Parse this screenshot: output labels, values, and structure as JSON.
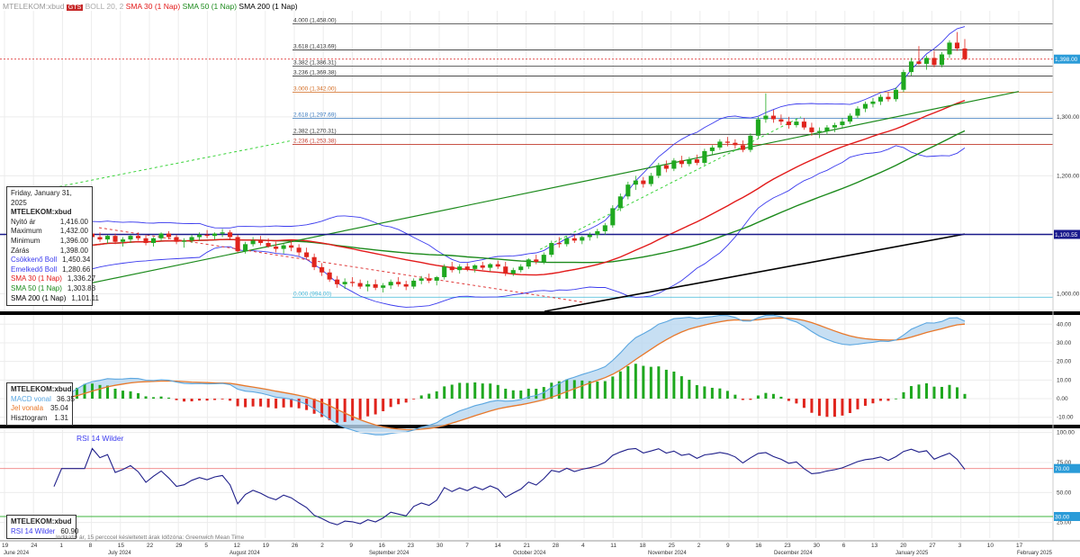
{
  "header": {
    "symbol_label": "MTELEKOM:xbud",
    "badge_label": "GTS",
    "extra_label": "BOLL 20, 2",
    "sma30_label": "SMA 30 (1 Nap)",
    "sma50_label": "SMA 50 (1 Nap)",
    "sma200_label": "SMA 200 (1 Nap)"
  },
  "colors": {
    "up": "#1fa81f",
    "down": "#e0241c",
    "sma30": "#e21a1a",
    "sma50": "#1c8a1c",
    "sma200": "#000000",
    "boll": "#3a3aee",
    "macd": "#5aa6e0",
    "signal": "#e8782a",
    "rsi": "#1f1f8a",
    "fib": "#d2691e"
  },
  "price_info": {
    "date": "Friday, January 31, 2025",
    "symbol": "MTELEKOM:xbud",
    "rows": [
      {
        "label": "Nyitó ár",
        "value": "1,416.00"
      },
      {
        "label": "Maximum",
        "value": "1,432.00"
      },
      {
        "label": "Minimum",
        "value": "1,396.00"
      },
      {
        "label": "Zárás",
        "value": "1,398.00"
      },
      {
        "label": "Csökkenő Boll",
        "value": "1,450.34"
      },
      {
        "label": "Emelkedő Boll",
        "value": "1,280.66"
      },
      {
        "label": "SMA 30 (1 Nap)",
        "value": "1,336.27"
      },
      {
        "label": "SMA 50 (1 Nap)",
        "value": "1,303.88"
      },
      {
        "label": "SMA 200 (1 Nap)",
        "value": "1,101.11"
      }
    ]
  },
  "macd_info": {
    "symbol": "MTELEKOM:xbud",
    "rows": [
      {
        "label": "MACD vonal",
        "value": "36.35"
      },
      {
        "label": "Jel vonala",
        "value": "35.04"
      },
      {
        "label": "Hisztogram",
        "value": "1.31"
      }
    ]
  },
  "rsi_info": {
    "title": "RSI 14 Wilder",
    "symbol": "MTELEKOM:xbud",
    "label": "RSI 14 Wilder",
    "value": "60.90"
  },
  "footer_note": "Indikatív ár, 15 percccel késleltetett árak   Időzóna: Greenwich Mean Time",
  "chart_data": {
    "type": "candlestick",
    "price_axis": {
      "ticks": [
        "1,000.00",
        "1,100.00",
        "1,200.00",
        "1,300.00"
      ],
      "ylim": [
        970,
        1480
      ]
    },
    "price_tags": {
      "current": "1,398.00",
      "sma200": "1,100.55"
    },
    "fib_levels": [
      {
        "label": "4.000 (1,458.00)",
        "value": 1458
      },
      {
        "label": "3.618 (1,413.69)",
        "value": 1413.69
      },
      {
        "label": "3.382 (1,386.31)",
        "value": 1386.31
      },
      {
        "label": "3.236 (1,369.38)",
        "value": 1369.38
      },
      {
        "label": "3.000 (1,342.00)",
        "value": 1342
      },
      {
        "label": "2.618 (1,297.69)",
        "value": 1297.69
      },
      {
        "label": "2.382 (1,270.31)",
        "value": 1270.31
      },
      {
        "label": "2.236 (1,253.38)",
        "value": 1253.38
      },
      {
        "label": "0.000 (994.00)",
        "value": 994
      }
    ],
    "candles": [
      [
        1045,
        1058,
        1040,
        1055
      ],
      [
        1055,
        1070,
        1050,
        1066
      ],
      [
        1066,
        1085,
        1062,
        1080
      ],
      [
        1080,
        1100,
        1075,
        1095
      ],
      [
        1095,
        1110,
        1088,
        1102
      ],
      [
        1102,
        1108,
        1090,
        1096
      ],
      [
        1096,
        1104,
        1088,
        1092
      ],
      [
        1092,
        1100,
        1085,
        1098
      ],
      [
        1098,
        1102,
        1084,
        1088
      ],
      [
        1088,
        1096,
        1080,
        1092
      ],
      [
        1092,
        1100,
        1086,
        1098
      ],
      [
        1098,
        1104,
        1090,
        1094
      ],
      [
        1094,
        1100,
        1082,
        1086
      ],
      [
        1086,
        1096,
        1080,
        1094
      ],
      [
        1094,
        1104,
        1090,
        1102
      ],
      [
        1102,
        1106,
        1092,
        1096
      ],
      [
        1096,
        1100,
        1084,
        1088
      ],
      [
        1088,
        1094,
        1078,
        1090
      ],
      [
        1090,
        1100,
        1086,
        1096
      ],
      [
        1096,
        1104,
        1090,
        1100
      ],
      [
        1100,
        1108,
        1094,
        1098
      ],
      [
        1098,
        1104,
        1092,
        1102
      ],
      [
        1102,
        1110,
        1096,
        1104
      ],
      [
        1104,
        1108,
        1092,
        1096
      ],
      [
        1096,
        1100,
        1070,
        1072
      ],
      [
        1072,
        1088,
        1068,
        1084
      ],
      [
        1084,
        1096,
        1080,
        1090
      ],
      [
        1090,
        1098,
        1082,
        1086
      ],
      [
        1086,
        1094,
        1078,
        1080
      ],
      [
        1080,
        1088,
        1070,
        1076
      ],
      [
        1076,
        1086,
        1068,
        1082
      ],
      [
        1082,
        1090,
        1072,
        1078
      ],
      [
        1078,
        1084,
        1064,
        1070
      ],
      [
        1070,
        1078,
        1058,
        1062
      ],
      [
        1062,
        1068,
        1040,
        1045
      ],
      [
        1045,
        1052,
        1030,
        1036
      ],
      [
        1036,
        1042,
        1020,
        1024
      ],
      [
        1024,
        1030,
        1010,
        1016
      ],
      [
        1016,
        1026,
        1008,
        1020
      ],
      [
        1020,
        1028,
        1012,
        1018
      ],
      [
        1018,
        1024,
        1008,
        1012
      ],
      [
        1012,
        1022,
        1004,
        1016
      ],
      [
        1016,
        1024,
        1006,
        1010
      ],
      [
        1010,
        1018,
        1002,
        1014
      ],
      [
        1014,
        1024,
        1008,
        1020
      ],
      [
        1020,
        1028,
        1012,
        1016
      ],
      [
        1016,
        1022,
        1006,
        1012
      ],
      [
        1012,
        1026,
        1008,
        1022
      ],
      [
        1022,
        1030,
        1016,
        1026
      ],
      [
        1026,
        1034,
        1018,
        1022
      ],
      [
        1022,
        1030,
        1014,
        1028
      ],
      [
        1028,
        1050,
        1024,
        1046
      ],
      [
        1046,
        1054,
        1036,
        1040
      ],
      [
        1040,
        1050,
        1034,
        1046
      ],
      [
        1046,
        1052,
        1038,
        1042
      ],
      [
        1042,
        1050,
        1036,
        1048
      ],
      [
        1048,
        1054,
        1040,
        1044
      ],
      [
        1044,
        1052,
        1038,
        1050
      ],
      [
        1050,
        1056,
        1042,
        1046
      ],
      [
        1046,
        1054,
        1030,
        1034
      ],
      [
        1034,
        1044,
        1030,
        1040
      ],
      [
        1040,
        1050,
        1036,
        1046
      ],
      [
        1046,
        1060,
        1042,
        1058
      ],
      [
        1058,
        1066,
        1050,
        1054
      ],
      [
        1054,
        1070,
        1050,
        1066
      ],
      [
        1066,
        1090,
        1062,
        1086
      ],
      [
        1086,
        1096,
        1078,
        1084
      ],
      [
        1084,
        1098,
        1080,
        1094
      ],
      [
        1094,
        1100,
        1086,
        1090
      ],
      [
        1090,
        1098,
        1084,
        1096
      ],
      [
        1096,
        1104,
        1090,
        1100
      ],
      [
        1100,
        1110,
        1094,
        1106
      ],
      [
        1106,
        1120,
        1100,
        1116
      ],
      [
        1116,
        1150,
        1112,
        1145
      ],
      [
        1145,
        1170,
        1140,
        1165
      ],
      [
        1165,
        1190,
        1160,
        1185
      ],
      [
        1185,
        1200,
        1176,
        1192
      ],
      [
        1192,
        1198,
        1180,
        1186
      ],
      [
        1186,
        1205,
        1182,
        1200
      ],
      [
        1200,
        1222,
        1196,
        1218
      ],
      [
        1218,
        1226,
        1206,
        1212
      ],
      [
        1212,
        1230,
        1208,
        1226
      ],
      [
        1226,
        1234,
        1214,
        1220
      ],
      [
        1220,
        1232,
        1216,
        1228
      ],
      [
        1228,
        1236,
        1218,
        1222
      ],
      [
        1222,
        1246,
        1218,
        1242
      ],
      [
        1242,
        1252,
        1236,
        1248
      ],
      [
        1248,
        1262,
        1244,
        1258
      ],
      [
        1258,
        1266,
        1250,
        1256
      ],
      [
        1256,
        1262,
        1246,
        1252
      ],
      [
        1252,
        1260,
        1240,
        1244
      ],
      [
        1244,
        1272,
        1240,
        1268
      ],
      [
        1268,
        1300,
        1264,
        1296
      ],
      [
        1296,
        1340,
        1290,
        1302
      ],
      [
        1302,
        1312,
        1290,
        1296
      ],
      [
        1296,
        1304,
        1286,
        1292
      ],
      [
        1292,
        1300,
        1280,
        1286
      ],
      [
        1286,
        1296,
        1282,
        1292
      ],
      [
        1292,
        1298,
        1278,
        1282
      ],
      [
        1282,
        1290,
        1268,
        1274
      ],
      [
        1274,
        1282,
        1264,
        1276
      ],
      [
        1276,
        1286,
        1270,
        1282
      ],
      [
        1282,
        1290,
        1274,
        1286
      ],
      [
        1286,
        1298,
        1280,
        1292
      ],
      [
        1292,
        1306,
        1288,
        1302
      ],
      [
        1302,
        1318,
        1298,
        1314
      ],
      [
        1314,
        1326,
        1308,
        1322
      ],
      [
        1322,
        1332,
        1316,
        1326
      ],
      [
        1326,
        1338,
        1320,
        1334
      ],
      [
        1334,
        1342,
        1326,
        1330
      ],
      [
        1330,
        1350,
        1326,
        1346
      ],
      [
        1346,
        1380,
        1342,
        1376
      ],
      [
        1376,
        1400,
        1370,
        1394
      ],
      [
        1394,
        1420,
        1388,
        1390
      ],
      [
        1390,
        1404,
        1380,
        1400
      ],
      [
        1400,
        1412,
        1384,
        1388
      ],
      [
        1388,
        1410,
        1384,
        1406
      ],
      [
        1406,
        1430,
        1400,
        1426
      ],
      [
        1426,
        1444,
        1412,
        1416
      ],
      [
        1416,
        1432,
        1396,
        1398
      ]
    ],
    "macd_axis": {
      "ticks": [
        "-10.00",
        "0.00",
        "10.00",
        "20.00",
        "30.00",
        "40.00"
      ],
      "ylim": [
        -14,
        44
      ]
    },
    "rsi_axis": {
      "ticks": [
        "25.00",
        "50.00",
        "75.00",
        "100.00"
      ],
      "ylim": [
        12,
        102
      ],
      "levels": [
        "30.00",
        "70.00"
      ]
    },
    "x_axis": {
      "day_ticks": [
        "19",
        "24",
        "1",
        "8",
        "15",
        "22",
        "29",
        "5",
        "12",
        "19",
        "26",
        "2",
        "9",
        "16",
        "23",
        "30",
        "7",
        "14",
        "21",
        "28",
        "4",
        "11",
        "18",
        "25",
        "2",
        "9",
        "16",
        "23",
        "30",
        "6",
        "13",
        "20",
        "27",
        "3",
        "10",
        "17"
      ],
      "months": [
        "June 2024",
        "July 2024",
        "August 2024",
        "September 2024",
        "October 2024",
        "November 2024",
        "December 2024",
        "January 2025",
        "February 2025"
      ]
    }
  }
}
